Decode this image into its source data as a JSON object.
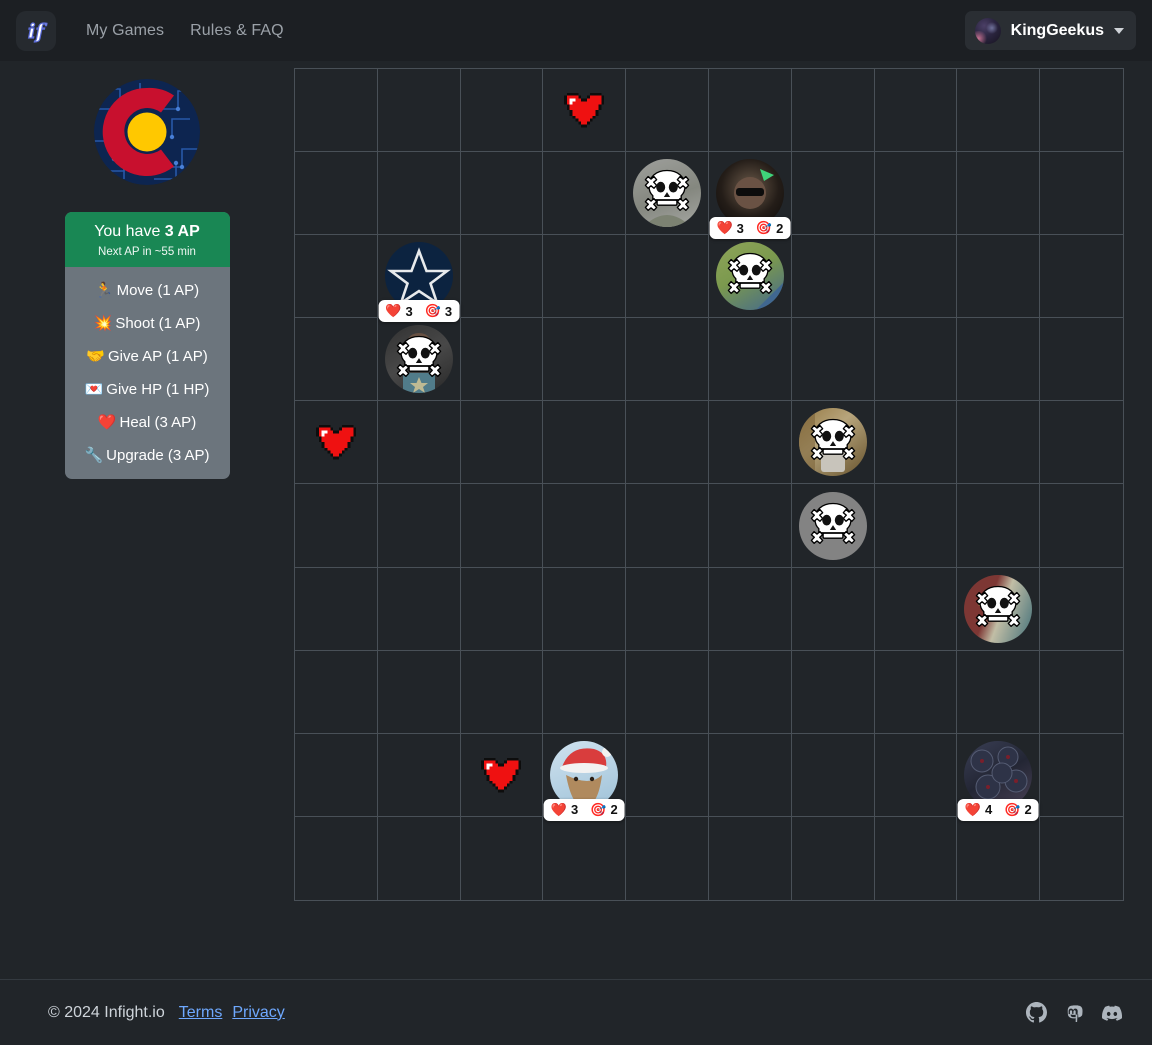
{
  "navbar": {
    "brand_icon": "infight-logo-icon",
    "brand_alt": "if",
    "links": [
      {
        "label": "My Games",
        "name": "nav-link-my-games"
      },
      {
        "label": "Rules & FAQ",
        "name": "nav-link-rules-faq"
      }
    ],
    "user": {
      "name": "KingGeekus",
      "avatar_icon": "user-avatar",
      "caret_icon": "chevron-down-icon"
    }
  },
  "sidebar": {
    "game_logo_icon": "colorado-flag-circuit-logo",
    "action_panel": {
      "ap_prefix": "You have ",
      "ap_amount": "3 AP",
      "next_ap": "Next AP in ~55 min",
      "actions": [
        {
          "emoji": "🏃",
          "label": "Move (1 AP)",
          "name": "action-move"
        },
        {
          "emoji": "💥",
          "label": "Shoot (1 AP)",
          "name": "action-shoot"
        },
        {
          "emoji": "🤝",
          "label": "Give AP (1 AP)",
          "name": "action-give-ap"
        },
        {
          "emoji": "💌",
          "label": "Give HP (1 HP)",
          "name": "action-give-hp"
        },
        {
          "emoji": "❤️",
          "label": "Heal (3 AP)",
          "name": "action-heal"
        },
        {
          "emoji": "🔧",
          "label": "Upgrade (3 AP)",
          "name": "action-upgrade"
        }
      ]
    }
  },
  "board": {
    "columns": 10,
    "rows": 10,
    "grid_line_color": "#495057",
    "cell_bg": "#212529",
    "tokens": [
      {
        "name": "heart-pickup",
        "type": "heart",
        "col": 4,
        "row": 1
      },
      {
        "name": "player-token-dead",
        "type": "player",
        "col": 5,
        "row": 2,
        "alive": false,
        "avatar": "gray-portrait"
      },
      {
        "name": "player-token",
        "type": "player",
        "col": 6,
        "row": 2,
        "alive": true,
        "hp": "3",
        "range": "2",
        "avatar": "sunglasses-party"
      },
      {
        "name": "player-token",
        "type": "player",
        "col": 2,
        "row": 3,
        "alive": true,
        "hp": "3",
        "range": "3",
        "avatar": "cowboys-star"
      },
      {
        "name": "player-token-dead",
        "type": "player",
        "col": 6,
        "row": 3,
        "alive": false,
        "avatar": "green-field"
      },
      {
        "name": "player-token-dead",
        "type": "player",
        "col": 2,
        "row": 4,
        "alive": false,
        "avatar": "anime-character"
      },
      {
        "name": "heart-pickup",
        "type": "heart",
        "col": 1,
        "row": 5
      },
      {
        "name": "player-token-dead",
        "type": "player",
        "col": 7,
        "row": 5,
        "alive": false,
        "avatar": "gold-portrait"
      },
      {
        "name": "player-token-dead",
        "type": "player",
        "col": 7,
        "row": 6,
        "alive": false,
        "avatar": "plain-gray"
      },
      {
        "name": "player-token-dead",
        "type": "player",
        "col": 9,
        "row": 7,
        "alive": false,
        "avatar": "red-teal-art"
      },
      {
        "name": "heart-pickup",
        "type": "heart",
        "col": 3,
        "row": 9
      },
      {
        "name": "player-token",
        "type": "player",
        "col": 4,
        "row": 9,
        "alive": true,
        "hp": "3",
        "range": "2",
        "avatar": "santa-hat"
      },
      {
        "name": "player-token",
        "type": "player",
        "col": 9,
        "row": 9,
        "alive": true,
        "hp": "4",
        "range": "2",
        "avatar": "dark-roses"
      }
    ],
    "stat_icons": {
      "hp": "❤️",
      "range": "🎯"
    }
  },
  "footer": {
    "copyright": "© 2024 Infight.io",
    "links": [
      {
        "label": "Terms",
        "name": "footer-link-terms"
      },
      {
        "label": "Privacy",
        "name": "footer-link-privacy"
      }
    ],
    "socials": [
      {
        "name": "github-icon"
      },
      {
        "name": "mastodon-icon"
      },
      {
        "name": "discord-icon"
      }
    ]
  },
  "colors": {
    "navbar_bg": "#1c1f23",
    "body_bg": "#212529",
    "accent_green": "#198754",
    "panel_gray": "#6c757d",
    "link_blue": "#6ea8fe"
  }
}
